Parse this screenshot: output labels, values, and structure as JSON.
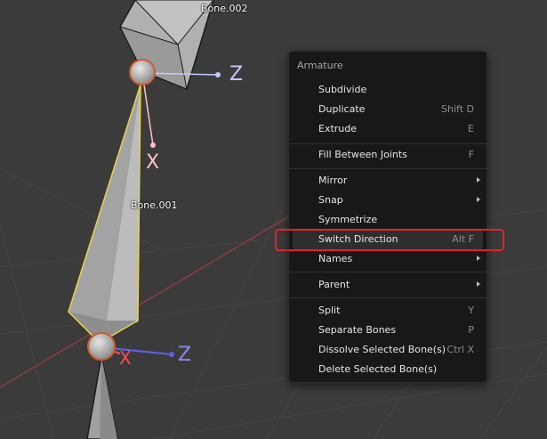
{
  "viewport": {
    "bone_labels": [
      "Bone.002",
      "Bone.001"
    ],
    "axis_labels": {
      "top_z": "Z",
      "top_x": "X",
      "bottom_z": "Z",
      "bottom_x": "X"
    },
    "colors": {
      "background": "#3b3b3b",
      "grid": "#454545",
      "x_axis_line": "#8a3d43",
      "bone_fill": "#a9a9a9",
      "selected_outline": "#e8d24a",
      "joint_outline": "#d2592c",
      "z_axis": "#c8c8ff",
      "x_axis": "#ffc0c8",
      "bottom_z_axis": "#6060e6",
      "bottom_x_axis": "#ff4a5a"
    }
  },
  "menu": {
    "title": "Armature",
    "items": [
      {
        "label": "Subdivide",
        "shortcut": ""
      },
      {
        "label": "Duplicate",
        "shortcut": "Shift D"
      },
      {
        "label": "Extrude",
        "shortcut": "E"
      },
      {
        "label": "Fill Between Joints",
        "shortcut": "F"
      },
      {
        "label": "Mirror",
        "shortcut": "",
        "submenu": true
      },
      {
        "label": "Snap",
        "shortcut": "",
        "submenu": true
      },
      {
        "label": "Symmetrize",
        "shortcut": ""
      },
      {
        "label": "Switch Direction",
        "shortcut": "Alt F"
      },
      {
        "label": "Names",
        "shortcut": "",
        "submenu": true
      },
      {
        "label": "Parent",
        "shortcut": "",
        "submenu": true
      },
      {
        "label": "Split",
        "shortcut": "Y"
      },
      {
        "label": "Separate Bones",
        "shortcut": "P"
      },
      {
        "label": "Dissolve Selected Bone(s)",
        "shortcut": "Ctrl X"
      },
      {
        "label": "Delete Selected Bone(s)",
        "shortcut": ""
      }
    ],
    "highlighted_item": "Switch Direction",
    "highlight_color": "#e0242a"
  }
}
